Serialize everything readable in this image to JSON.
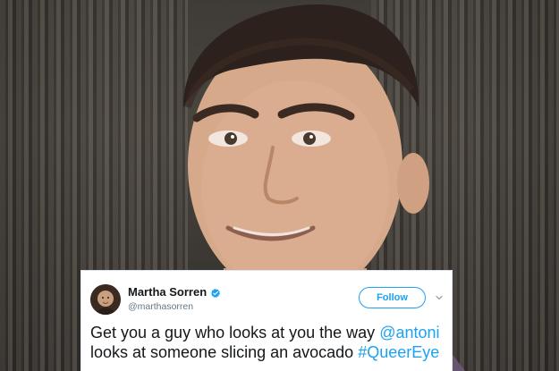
{
  "tweet": {
    "display_name": "Martha Sorren",
    "handle": "@marthasorren",
    "follow_label": "Follow",
    "text_part1": "Get you a guy who looks at you the way ",
    "mention": "@antoni",
    "text_part2": " looks at someone slicing an avocado ",
    "hashtag": "#QueerEye"
  },
  "colors": {
    "brand_blue": "#1da1f2",
    "text_dark": "#14171a",
    "text_muted": "#657786"
  },
  "icons": {
    "verified": "verified-badge-icon",
    "caret": "chevron-down-icon"
  }
}
